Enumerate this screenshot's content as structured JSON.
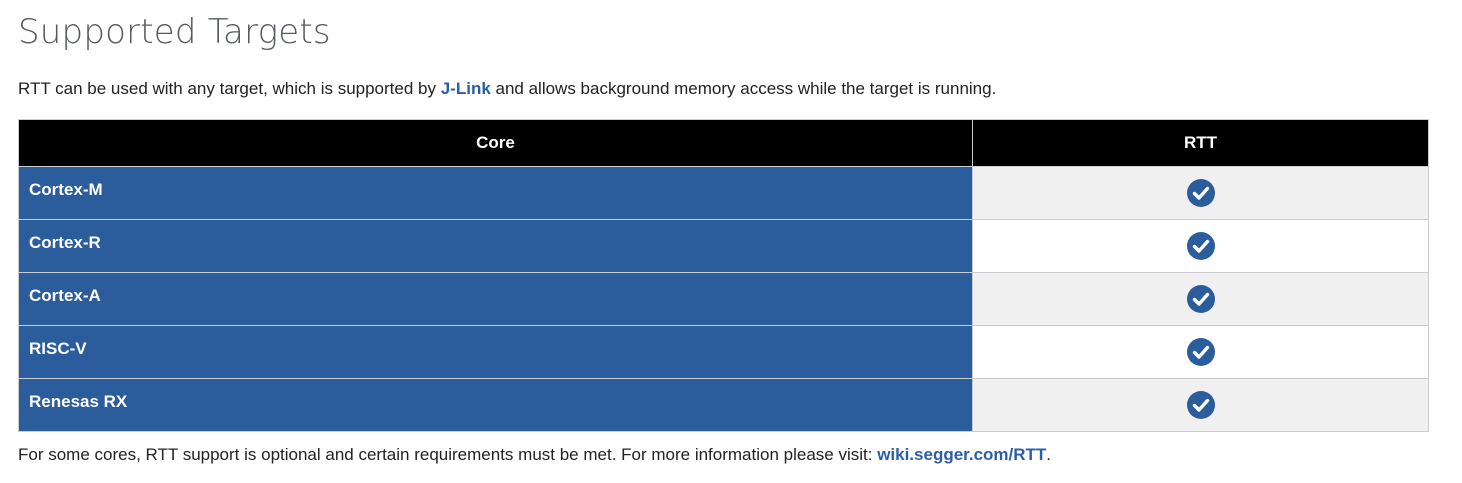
{
  "page": {
    "title": "Supported Targets",
    "intro": {
      "before": "RTT can be used with any target, which is supported by ",
      "link_text": "J-Link",
      "after": " and allows background memory access while the target is running."
    },
    "table": {
      "headers": [
        "Core",
        "RTT"
      ],
      "rows": [
        {
          "core": "Cortex-M",
          "rtt_icon": "check-circle-icon"
        },
        {
          "core": "Cortex-R",
          "rtt_icon": "check-circle-icon"
        },
        {
          "core": "Cortex-A",
          "rtt_icon": "check-circle-icon"
        },
        {
          "core": "RISC-V",
          "rtt_icon": "check-circle-icon"
        },
        {
          "core": "Renesas RX",
          "rtt_icon": "check-circle-icon"
        }
      ]
    },
    "footer": {
      "before": "For some cores, RTT support is optional and certain requirements must be met. For more information please visit: ",
      "link_text": "wiki.segger.com/RTT",
      "after": "."
    }
  },
  "colors": {
    "link": "#2b5ea8",
    "core_cell_bg": "#2b5c9c",
    "header_bg": "#000000",
    "check_icon": "#2b5c9c"
  }
}
